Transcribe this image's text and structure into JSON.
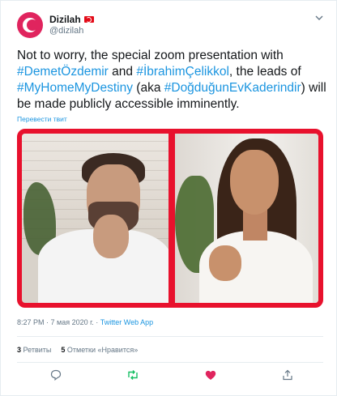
{
  "tweet": {
    "author": {
      "display_name": "Dizilah",
      "handle": "@dizilah"
    },
    "text_parts": [
      {
        "text": "Not to worry, the special zoom presentation with ",
        "type": "text"
      },
      {
        "text": "#DemetÖzdemir",
        "type": "hashtag"
      },
      {
        "text": " and ",
        "type": "text"
      },
      {
        "text": "#İbrahimÇelikkol",
        "type": "hashtag"
      },
      {
        "text": ", the leads of ",
        "type": "text"
      },
      {
        "text": "#MyHomeMyDestiny",
        "type": "hashtag"
      },
      {
        "text": " (aka ",
        "type": "text"
      },
      {
        "text": "#DoğduğunEvKaderindir",
        "type": "hashtag"
      },
      {
        "text": ") will be made publicly accessible imminently.",
        "type": "text"
      }
    ],
    "translate_label": "Перевести твит",
    "time": "8:27 PM · 7 мая 2020 г.",
    "separator": " · ",
    "source": "Twitter Web App",
    "retweets_count": "3",
    "retweets_label": "Ретвиты",
    "likes_count": "5",
    "likes_label": "Отметки «Нравится»"
  },
  "colors": {
    "accent": "#1b95e0",
    "media_border": "#e8112d",
    "retweet": "#17bf63",
    "like": "#e0245e",
    "secondary_text": "#657786"
  },
  "icons": [
    "reply-icon",
    "retweet-icon",
    "like-icon",
    "share-icon",
    "chevron-down-icon"
  ]
}
